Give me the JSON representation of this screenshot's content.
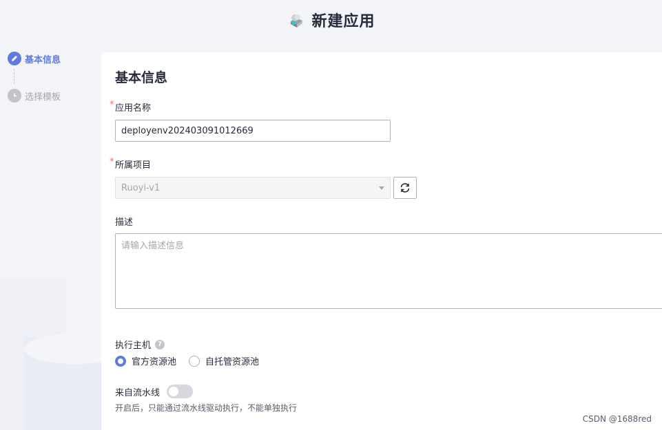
{
  "header": {
    "title": "新建应用",
    "icon": "cloud-app-icon"
  },
  "steps": [
    {
      "label": "基本信息",
      "state": "active",
      "icon": "pencil-icon"
    },
    {
      "label": "选择模板",
      "state": "inactive",
      "icon": "clock-icon"
    }
  ],
  "form": {
    "section_title": "基本信息",
    "app_name": {
      "label": "应用名称",
      "required": "*",
      "value": "deployenv202403091012669"
    },
    "project": {
      "label": "所属项目",
      "required": "*",
      "value": "Ruoyi-v1"
    },
    "description": {
      "label": "描述",
      "placeholder": "请输入描述信息"
    },
    "host": {
      "label": "执行主机",
      "help": "?",
      "options": [
        "官方资源池",
        "自托管资源池"
      ],
      "selected": "官方资源池"
    },
    "pipeline": {
      "label": "来自流水线",
      "enabled": false,
      "hint": "开启后，只能通过流水线驱动执行，不能单独执行"
    }
  },
  "watermark": "CSDN @1688red",
  "colors": {
    "accent": "#5e7ce0",
    "required": "#f66f6a",
    "border": "#adb0b8",
    "text": "#252b3a"
  }
}
